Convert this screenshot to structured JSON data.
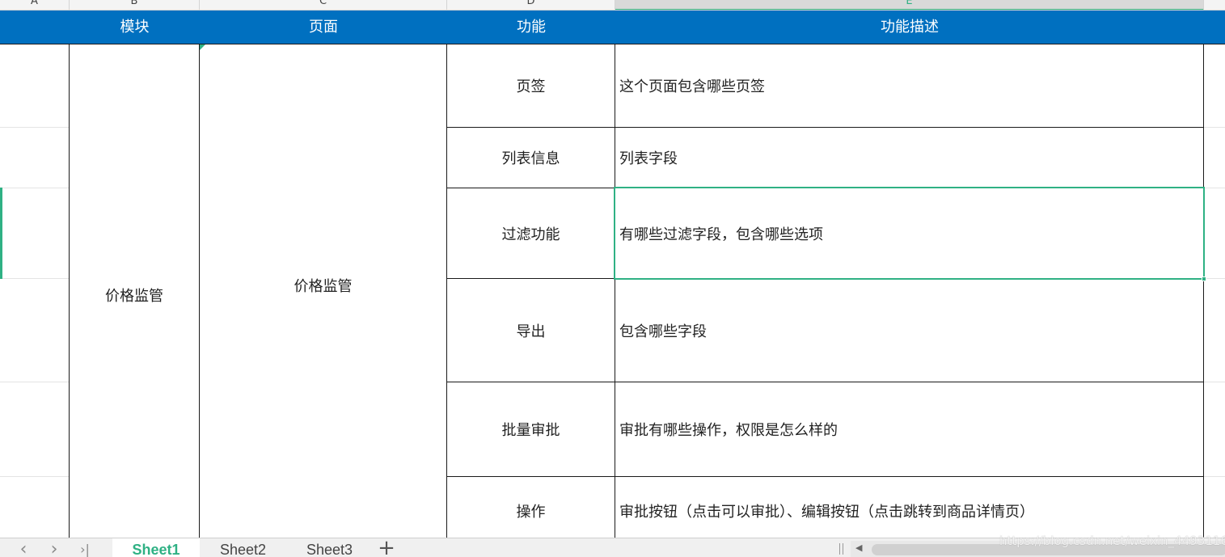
{
  "column_headers": [
    "A",
    "B",
    "C",
    "D",
    "E"
  ],
  "table": {
    "headers": [
      "模块",
      "页面",
      "功能",
      "功能描述"
    ],
    "module": "价格监管",
    "page": "价格监管",
    "rows": [
      {
        "feature": "页签",
        "description": "这个页面包含哪些页签"
      },
      {
        "feature": "列表信息",
        "description": "列表字段"
      },
      {
        "feature": "过滤功能",
        "description": "有哪些过滤字段，包含哪些选项"
      },
      {
        "feature": "导出",
        "description": "包含哪些字段"
      },
      {
        "feature": "批量审批",
        "description": "审批有哪些操作，权限是怎么样的"
      },
      {
        "feature": "操作",
        "description": "审批按钮（点击可以审批）、编辑按钮（点击跳转到商品详情页）"
      }
    ]
  },
  "sheets": [
    "Sheet1",
    "Sheet2",
    "Sheet3"
  ],
  "active_sheet": "Sheet1",
  "icons": {
    "prev": "chevron-left-icon",
    "next": "chevron-right-icon",
    "last": "last-sheet-icon",
    "add": "plus-icon"
  },
  "watermark": "https://blog.csdn.net/weixin_44931166",
  "colors": {
    "header_bg": "#0070c0",
    "header_text": "#ffffff",
    "accent": "#2fb184",
    "grid_line": "#1a1a1a"
  }
}
